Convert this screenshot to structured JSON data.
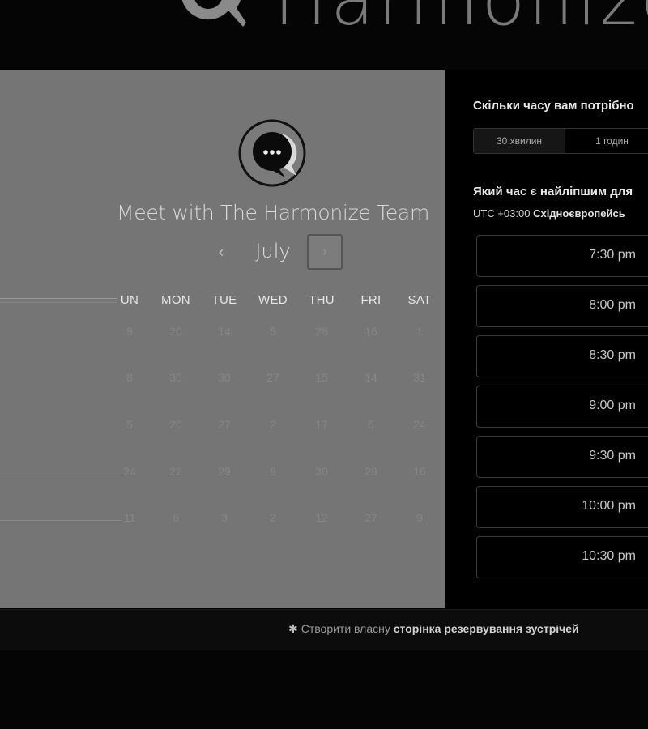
{
  "header": {
    "brand_name": "Harmonize"
  },
  "calendar": {
    "meeting_title": "Meet with The Harmonize Team",
    "month": "July",
    "prev_icon": "‹",
    "next_icon": "›",
    "weekdays": [
      "UN",
      "MON",
      "TUE",
      "WED",
      "THU",
      "FRI",
      "SAT"
    ],
    "weeks": [
      [
        "9",
        "20",
        "14",
        "5",
        "28",
        "16",
        "1"
      ],
      [
        "8",
        "30",
        "30",
        "27",
        "15",
        "14",
        "31"
      ],
      [
        "5",
        "20",
        "27",
        "2",
        "17",
        "6",
        "24"
      ],
      [
        "24",
        "22",
        "29",
        "9",
        "30",
        "29",
        "16"
      ],
      [
        "11",
        "6",
        "3",
        "2",
        "12",
        "27",
        "9"
      ]
    ]
  },
  "booking": {
    "duration_question": "Скільки часу вам потрібно",
    "duration_options": [
      "30 хвилин",
      "1 годин"
    ],
    "time_question": "Який час є найліпшим для",
    "timezone_prefix": "UTC +03:00",
    "timezone_name": "Східноєвропейсь",
    "slots": [
      "7:30 pm",
      "8:00 pm",
      "8:30 pm",
      "9:00 pm",
      "9:30 pm",
      "10:00 pm",
      "10:30 pm"
    ]
  },
  "footer": {
    "link_prefix": "Створити власну",
    "link_bold": "сторінка резервування зустрічей"
  },
  "colors": {
    "left_panel": "#757575",
    "right_panel": "#000000",
    "accent": "#e8e8e8"
  }
}
